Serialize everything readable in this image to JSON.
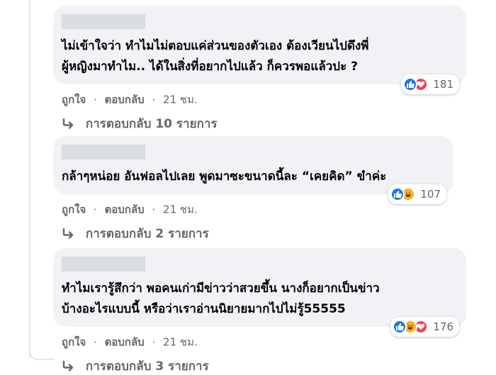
{
  "comments": [
    {
      "text": "ไม่เข้าใจว่า ทำไมไม่ตอบแค่ส่วนของตัวเอง ต้องเวียนไปดึงพี่\nผู้หญิงมาทำไม.. ได้ในสิ่งที่อยากไปแล้ว ก็ควรพอแล้วปะ ?",
      "reaction_icons": [
        "like-icon",
        "love-icon"
      ],
      "reaction_count": "181",
      "like_label": "ถูกใจ",
      "reply_label": "ตอบกลับ",
      "time": "21 ชม.",
      "view_replies": "การตอบกลับ 10 รายการ"
    },
    {
      "text": "กล้าๆหน่อย อันฟอลไปเลย พูดมาซะขนาดนี้ละ “เคยคิด” ขำค่ะ",
      "reaction_icons": [
        "like-icon",
        "haha-icon"
      ],
      "reaction_count": "107",
      "like_label": "ถูกใจ",
      "reply_label": "ตอบกลับ",
      "time": "21 ชม.",
      "view_replies": "การตอบกลับ 2 รายการ"
    },
    {
      "text": "ทำไมเรารู้สึกว่า พอคนเก่ามีข่าวว่าสวยขึ้น นางก็อยากเป็นข่าว\nบ้างอะไรแบบนี้ หรือว่าเราอ่านนิยายมากไปไม่รู้55555",
      "reaction_icons": [
        "like-icon",
        "haha-icon",
        "love-icon"
      ],
      "reaction_count": "176",
      "like_label": "ถูกใจ",
      "reply_label": "ตอบกลับ",
      "time": "21 ชม.",
      "view_replies": "การตอบกลับ 3 รายการ"
    }
  ],
  "separator": "·",
  "colors": {
    "bubble": "#f0f2f5",
    "secondary_text": "#65676b",
    "like": "#1877f2",
    "love": "#f33e58",
    "haha": "#f7b125"
  }
}
